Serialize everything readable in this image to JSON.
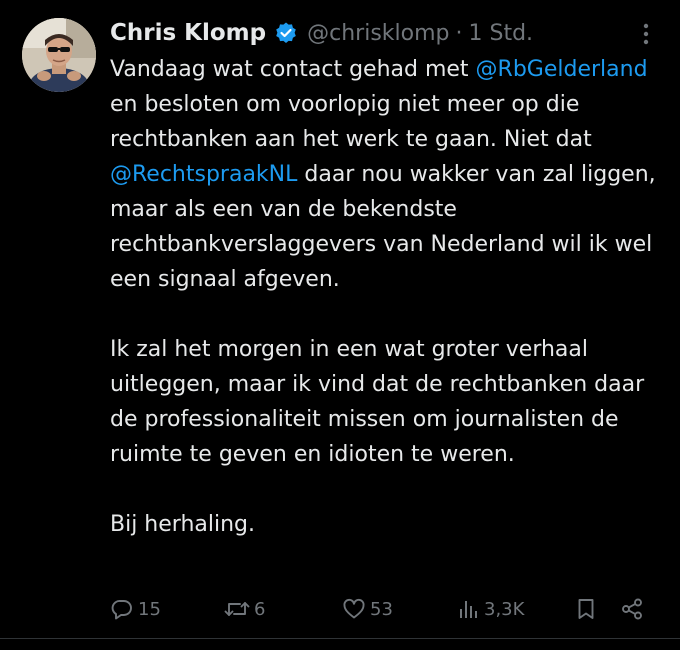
{
  "colors": {
    "background": "#000000",
    "text": "#e7e9ea",
    "secondary": "#71767b",
    "mention": "#1d9bf0",
    "verified": "#1d9bf0"
  },
  "tweet": {
    "author": {
      "name": "Chris Klomp",
      "handle": "@chrisklomp",
      "verified": true
    },
    "separator": "·",
    "time": "1 Std.",
    "paragraphs": [
      {
        "parts": [
          "Vandaag wat contact gehad met ",
          "@RbGelderland",
          " en besloten om voorlopig niet meer op die rechtbanken aan het werk te gaan. Niet dat ",
          "@RechtspraakNL",
          " daar nou wakker van zal liggen, maar als een van de bekendste rechtbankverslaggevers van Nederland wil ik wel een signaal afgeven."
        ]
      },
      {
        "text": "Ik zal het morgen in een wat groter verhaal uitleggen, maar ik vind dat de rechtbanken daar de professionaliteit missen om journalisten de ruimte te geven en idioten te weren."
      },
      {
        "text": "Bij herhaling."
      }
    ],
    "actions": {
      "replies": "15",
      "reposts": "6",
      "likes": "53",
      "views": "3,3K"
    },
    "icons": {
      "verified": "verified-badge-icon",
      "more": "more-options-icon",
      "reply": "reply-icon",
      "repost": "repost-icon",
      "like": "like-icon",
      "views": "views-icon",
      "bookmark": "bookmark-icon",
      "share": "share-icon"
    }
  }
}
